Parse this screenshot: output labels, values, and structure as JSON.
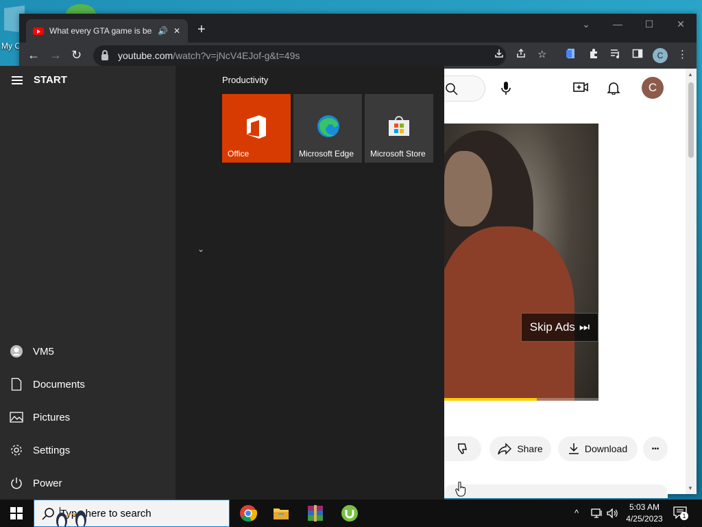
{
  "desktop": {
    "icon_label": "My C"
  },
  "browser": {
    "tab": {
      "title": "What every GTA game is best",
      "close": "✕",
      "audio": "🔊"
    },
    "new_tab": "+",
    "window_controls": [
      "⌄",
      "—",
      "☐",
      "✕"
    ],
    "url_host": "youtube.com",
    "url_path": "/watch?v=jNcV4EJof-g&t=49s",
    "profile_initial": "C"
  },
  "youtube": {
    "avatar_initial": "C",
    "skip_ads": "Skip Ads",
    "ad_progress": 0.6,
    "share": "Share",
    "download": "Download",
    "more": "•••"
  },
  "start_menu": {
    "title": "START",
    "group": "Productivity",
    "tiles": [
      {
        "label": "Office",
        "color": "#d83b01"
      },
      {
        "label": "Microsoft Edge",
        "color": "#3a3a3a"
      },
      {
        "label": "Microsoft Store",
        "color": "#3a3a3a"
      }
    ],
    "rail": [
      {
        "label": "VM5",
        "icon": "user-icon"
      },
      {
        "label": "Documents",
        "icon": "document-icon"
      },
      {
        "label": "Pictures",
        "icon": "pictures-icon"
      },
      {
        "label": "Settings",
        "icon": "gear-icon"
      },
      {
        "label": "Power",
        "icon": "power-icon"
      }
    ],
    "expand": "⌄"
  },
  "taskbar": {
    "search_placeholder": "Type here to search",
    "apps": [
      "chrome-icon",
      "file-explorer-icon",
      "winrar-icon",
      "utorrent-icon"
    ],
    "time": "5:03 AM",
    "date": "4/25/2023",
    "notification_count": "1"
  }
}
